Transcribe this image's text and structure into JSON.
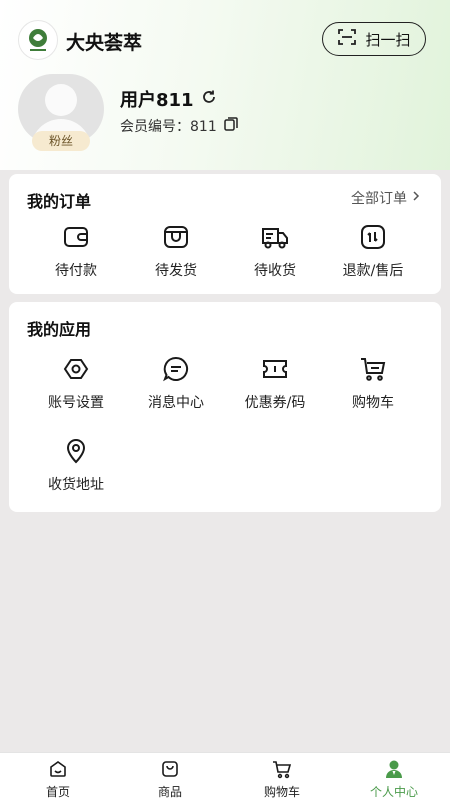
{
  "header": {
    "app_title": "大央荟萃",
    "scan_label": "扫一扫"
  },
  "profile": {
    "username": "用户811",
    "member_label": "会员编号：811",
    "badge": "粉丝"
  },
  "orders": {
    "title": "我的订单",
    "more_label": "全部订单",
    "items": [
      {
        "label": "待付款",
        "icon": "wallet-icon"
      },
      {
        "label": "待发货",
        "icon": "package-icon"
      },
      {
        "label": "待收货",
        "icon": "delivery-truck-icon"
      },
      {
        "label": "退款/售后",
        "icon": "refund-icon"
      }
    ]
  },
  "apps": {
    "title": "我的应用",
    "items": [
      {
        "label": "账号设置",
        "icon": "settings-icon"
      },
      {
        "label": "消息中心",
        "icon": "message-icon"
      },
      {
        "label": "优惠券/码",
        "icon": "coupon-icon"
      },
      {
        "label": "购物车",
        "icon": "cart-icon"
      },
      {
        "label": "收货地址",
        "icon": "location-icon"
      }
    ]
  },
  "tabbar": {
    "items": [
      {
        "label": "首页",
        "icon": "home-icon",
        "active": false
      },
      {
        "label": "商品",
        "icon": "bag-icon",
        "active": false
      },
      {
        "label": "购物车",
        "icon": "cart-icon",
        "active": false
      },
      {
        "label": "个人中心",
        "icon": "person-icon",
        "active": true
      }
    ]
  },
  "colors": {
    "accent": "#4a9a4a",
    "background": "#ebe9e9",
    "badge_bg": "#f6ead0"
  }
}
